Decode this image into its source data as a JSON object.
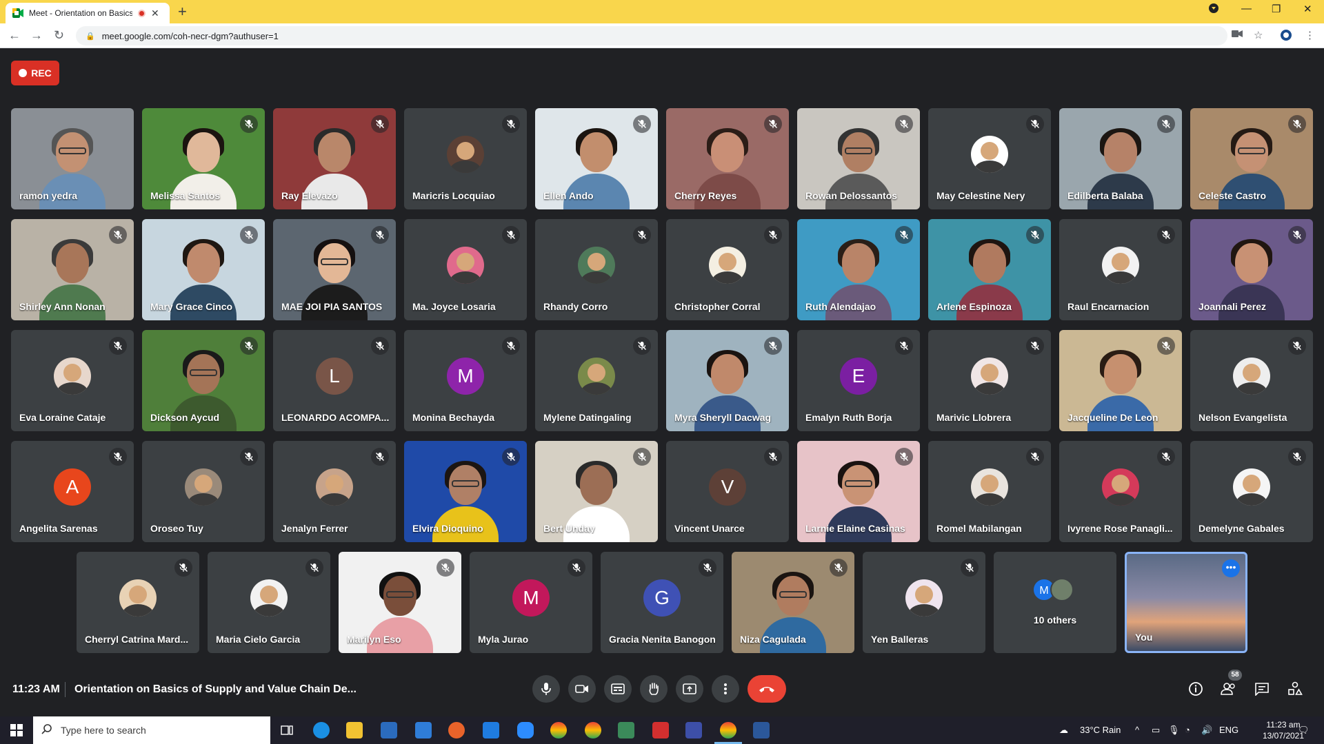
{
  "browser": {
    "tab_title": "Meet - Orientation on Basics",
    "url": "meet.google.com/coh-necr-dgm?authuser=1"
  },
  "meeting": {
    "rec_label": "REC",
    "time": "11:23 AM",
    "title": "Orientation on Basics of Supply and Value Chain De...",
    "participant_count": "58"
  },
  "tiles": [
    {
      "name": "ramon yedra",
      "kind": "video",
      "bg": "#8a8f95",
      "skin": "#c39173",
      "shirt": "#6a8fb5",
      "hair": "#555555"
    },
    {
      "name": "Melissa Santos",
      "kind": "video",
      "bg": "#4e8a3a",
      "skin": "#e0b89a",
      "shirt": "#f2efe9",
      "hair": "#1b1410"
    },
    {
      "name": "Ray Elevazo",
      "kind": "video",
      "bg": "#8f3a3a",
      "skin": "#b9876a",
      "shirt": "#e9e9e9",
      "hair": "#2a2a2a"
    },
    {
      "name": "Maricris Locquiao",
      "kind": "avatar",
      "avatar_bg": "#5b4035"
    },
    {
      "name": "Ellen Ando",
      "kind": "video",
      "bg": "#dfe6ea",
      "skin": "#c28e6d",
      "shirt": "#5b86b0",
      "hair": "#1a1410"
    },
    {
      "name": "Cherry Reyes",
      "kind": "video",
      "bg": "#9a6a66",
      "skin": "#c98f76",
      "shirt": "#7d4b48",
      "hair": "#2b1d17"
    },
    {
      "name": "Rowan Delossantos",
      "kind": "video",
      "bg": "#c9c6c0",
      "skin": "#b07f63",
      "shirt": "#5a5a5a",
      "hair": "#333333"
    },
    {
      "name": "May Celestine Nery",
      "kind": "avatar",
      "avatar_bg": "#ffffff"
    },
    {
      "name": "Edilberta Balaba",
      "kind": "video",
      "bg": "#9aa6ad",
      "skin": "#b68268",
      "shirt": "#2d3a4a",
      "hair": "#1c1612"
    },
    {
      "name": "Celeste Castro",
      "kind": "video",
      "bg": "#a98a6a",
      "skin": "#c59174",
      "shirt": "#2f4f72",
      "hair": "#251a14"
    },
    {
      "name": "Shirley Ann Nonan",
      "kind": "video",
      "bg": "#b9b2a6",
      "skin": "#a87659",
      "shirt": "#4f7a4f",
      "hair": "#3a3a3a"
    },
    {
      "name": "Mary Grace Cinco",
      "kind": "video",
      "bg": "#c7d6df",
      "skin": "#c08a6d",
      "shirt": "#2e4a63",
      "hair": "#1e1712"
    },
    {
      "name": "MAE JOI PIA SANTOS",
      "kind": "video",
      "bg": "#5c6670",
      "skin": "#e3b796",
      "shirt": "#1c1c1c",
      "hair": "#151010"
    },
    {
      "name": "Ma. Joyce Losaria",
      "kind": "avatar",
      "avatar_bg": "#e06a8c"
    },
    {
      "name": "Rhandy Corro",
      "kind": "avatar",
      "avatar_bg": "#4f7a5a"
    },
    {
      "name": "Christopher Corral",
      "kind": "avatar",
      "avatar_bg": "#f4efe2"
    },
    {
      "name": "Ruth Alendajao",
      "kind": "video",
      "bg": "#3f9bc4",
      "skin": "#b98468",
      "shirt": "#6a5a7a",
      "hair": "#2a1f18"
    },
    {
      "name": "Arlene Espinoza",
      "kind": "video",
      "bg": "#3e93a6",
      "skin": "#b07a5f",
      "shirt": "#8a3a4a",
      "hair": "#1e1511"
    },
    {
      "name": "Raul Encarnacion",
      "kind": "avatar",
      "avatar_bg": "#f2f2f2"
    },
    {
      "name": "Joannali Perez",
      "kind": "video",
      "bg": "#6b5a8a",
      "skin": "#c89174",
      "shirt": "#3a3555",
      "hair": "#201611"
    },
    {
      "name": "Eva Loraine Cataje",
      "kind": "avatar",
      "avatar_bg": "#e7d7cc"
    },
    {
      "name": "Dickson Aycud",
      "kind": "video",
      "bg": "#4f7f3a",
      "skin": "#a47457",
      "shirt": "#3d5a2e",
      "hair": "#1a1a1a"
    },
    {
      "name": "LEONARDO ACOMPA...",
      "kind": "letter",
      "letter": "L",
      "avatar_bg": "#795548"
    },
    {
      "name": "Monina Bechayda",
      "kind": "letter",
      "letter": "M",
      "avatar_bg": "#8e24aa"
    },
    {
      "name": "Mylene Datingaling",
      "kind": "avatar",
      "avatar_bg": "#7a8a4a"
    },
    {
      "name": "Myra Sheryll Dacwag",
      "kind": "video",
      "bg": "#9fb3bf",
      "skin": "#c0896b",
      "shirt": "#3a5a8a",
      "hair": "#1a1310"
    },
    {
      "name": "Emalyn Ruth Borja",
      "kind": "letter",
      "letter": "E",
      "avatar_bg": "#7b1fa2"
    },
    {
      "name": "Marivic Llobrera",
      "kind": "avatar",
      "avatar_bg": "#f0e6e6"
    },
    {
      "name": "Jacqueline De Leon",
      "kind": "video",
      "bg": "#cbb894",
      "skin": "#c6906f",
      "shirt": "#3a6aa8",
      "hair": "#2a1c14"
    },
    {
      "name": "Nelson Evangelista",
      "kind": "avatar",
      "avatar_bg": "#eeeeee"
    },
    {
      "name": "Angelita Sarenas",
      "kind": "letter",
      "letter": "A",
      "avatar_bg": "#e8461c"
    },
    {
      "name": "Oroseo Tuy",
      "kind": "avatar",
      "avatar_bg": "#9a8a7a"
    },
    {
      "name": "Jenalyn Ferrer",
      "kind": "avatar",
      "avatar_bg": "#c7a38a"
    },
    {
      "name": "Elvira Dioquino",
      "kind": "video",
      "bg": "#1f4aa8",
      "skin": "#b08066",
      "shirt": "#e8c21a",
      "hair": "#1c1512"
    },
    {
      "name": "Bert Unday",
      "kind": "video",
      "bg": "#d6d0c4",
      "skin": "#9c6e55",
      "shirt": "#ffffff",
      "hair": "#2a2a2a"
    },
    {
      "name": "Vincent Unarce",
      "kind": "letter",
      "letter": "V",
      "avatar_bg": "#5d4037"
    },
    {
      "name": "Larnie Elaine Casinas",
      "kind": "video",
      "bg": "#e7c3c8",
      "skin": "#c99375",
      "shirt": "#2f3a5a",
      "hair": "#1a1210"
    },
    {
      "name": "Romel Mabilangan",
      "kind": "avatar",
      "avatar_bg": "#e9e4de"
    },
    {
      "name": "Ivyrene Rose Panagli...",
      "kind": "avatar",
      "avatar_bg": "#d43a5a"
    },
    {
      "name": "Demelyne Gabales",
      "kind": "avatar",
      "avatar_bg": "#f5f5f5"
    },
    {
      "name": "Cherryl Catrina Mard...",
      "kind": "avatar",
      "avatar_bg": "#e8d2b5"
    },
    {
      "name": "Maria Cielo Garcia",
      "kind": "avatar",
      "avatar_bg": "#f2f2f2"
    },
    {
      "name": "Marilyn Eso",
      "kind": "video",
      "bg": "#f1f1f1",
      "skin": "#7a4e3a",
      "shirt": "#e8a0a6",
      "hair": "#111111"
    },
    {
      "name": "Myla Jurao",
      "kind": "letter",
      "letter": "M",
      "avatar_bg": "#c2185b"
    },
    {
      "name": "Gracia Nenita Banogon",
      "kind": "letter",
      "letter": "G",
      "avatar_bg": "#3f51b5"
    },
    {
      "name": "Niza Cagulada",
      "kind": "video",
      "bg": "#9c8a70",
      "skin": "#b07c5f",
      "shirt": "#2f6aa0",
      "hair": "#1a1411"
    },
    {
      "name": "Yen Balleras",
      "kind": "avatar",
      "avatar_bg": "#efe4ee"
    },
    {
      "name": "10 others",
      "kind": "others",
      "letter": "M"
    },
    {
      "name": "You",
      "kind": "self"
    }
  ],
  "taskbar": {
    "search_placeholder": "Type here to search",
    "weather": "33°C  Rain",
    "lang": "ENG",
    "clock_time": "11:23 am",
    "clock_date": "13/07/2021"
  },
  "colors": {
    "accent": "#1a73e8",
    "end_call": "#ea4335",
    "rec": "#d93025",
    "tab_bar": "#f9d64c"
  }
}
